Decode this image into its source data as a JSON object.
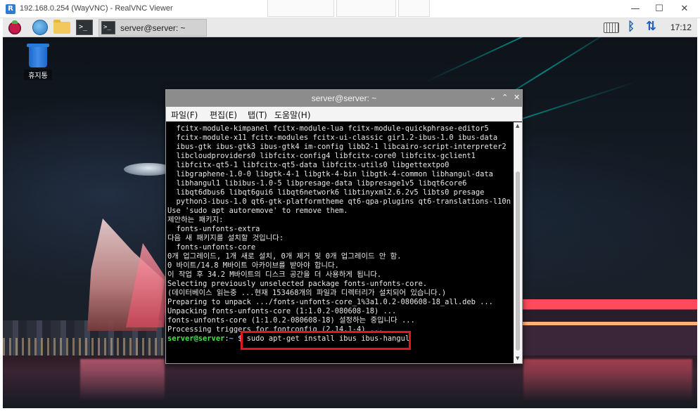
{
  "viewer": {
    "title": "192.168.0.254 (WayVNC) - RealVNC Viewer",
    "logo_letter": "R",
    "minimize": "—",
    "maximize": "☐",
    "close": "✕"
  },
  "taskbar": {
    "terminal_glyph": ">_",
    "active_task_label": "server@server: ~",
    "clock": "17:12",
    "bluetooth_glyph": "ᛒ",
    "network_glyph": "⇅"
  },
  "desktop": {
    "trash_label": "휴지통"
  },
  "terminal": {
    "title": "server@server: ~",
    "controls": {
      "minimize": "⌄",
      "maximize": "⌃",
      "close": "✕"
    },
    "menu": [
      {
        "label": "파일(F)"
      },
      {
        "label": "편집(E)"
      },
      {
        "label": "탭(T)"
      },
      {
        "label": "도움말(H)"
      }
    ],
    "lines": [
      "  fcitx-module-kimpanel fcitx-module-lua fcitx-module-quickphrase-editor5",
      "  fcitx-module-x11 fcitx-modules fcitx-ui-classic gir1.2-ibus-1.0 ibus-data",
      "  ibus-gtk ibus-gtk3 ibus-gtk4 im-config libb2-1 libcairo-script-interpreter2",
      "  libcloudproviders0 libfcitx-config4 libfcitx-core0 libfcitx-gclient1",
      "  libfcitx-qt5-1 libfcitx-qt5-data libfcitx-utils0 libgettextpo0",
      "  libgraphene-1.0-0 libgtk-4-1 libgtk-4-bin libgtk-4-common libhangul-data",
      "  libhangul1 libibus-1.0-5 libpresage-data libpresage1v5 libqt6core6",
      "  libqt6dbus6 libqt6gui6 libqt6network6 libtinyxml2.6.2v5 libts0 presage",
      "  python3-ibus-1.0 qt6-gtk-platformtheme qt6-qpa-plugins qt6-translations-l10n",
      "Use 'sudo apt autoremove' to remove them.",
      "제안하는 패키지:",
      "  fonts-unfonts-extra",
      "다음 새 패키지를 설치할 것입니다:",
      "  fonts-unfonts-core",
      "0개 업그레이드, 1개 새로 설치, 0개 제거 및 0개 업그레이드 안 함.",
      "0 바이트/14.8 M바이트 아카이브를 받아야 합니다.",
      "이 작업 후 34.2 M바이트의 디스크 공간을 더 사용하게 됩니다.",
      "Selecting previously unselected package fonts-unfonts-core.",
      "(데이터베이스 읽는중 ...현재 153468개의 파일과 디렉터리가 설치되어 있습니다.)",
      "Preparing to unpack .../fonts-unfonts-core_1%3a1.0.2-080608-18_all.deb ...",
      "Unpacking fonts-unfonts-core (1:1.0.2-080608-18) ...",
      "fonts-unfonts-core (1:1.0.2-080608-18) 설정하는 중입니다 ...",
      "Processing triggers for fontconfig (2.14.1-4) ..."
    ],
    "prompt": {
      "user": "server@server",
      "sep": ":",
      "path": "~",
      "symbol": " $ ",
      "command": "sudo apt-get install ibus ibus-hangul"
    }
  },
  "colors": {
    "highlight_box": "#e4161d",
    "prompt_user": "#4ce04c",
    "prompt_path": "#6aa5ff"
  }
}
